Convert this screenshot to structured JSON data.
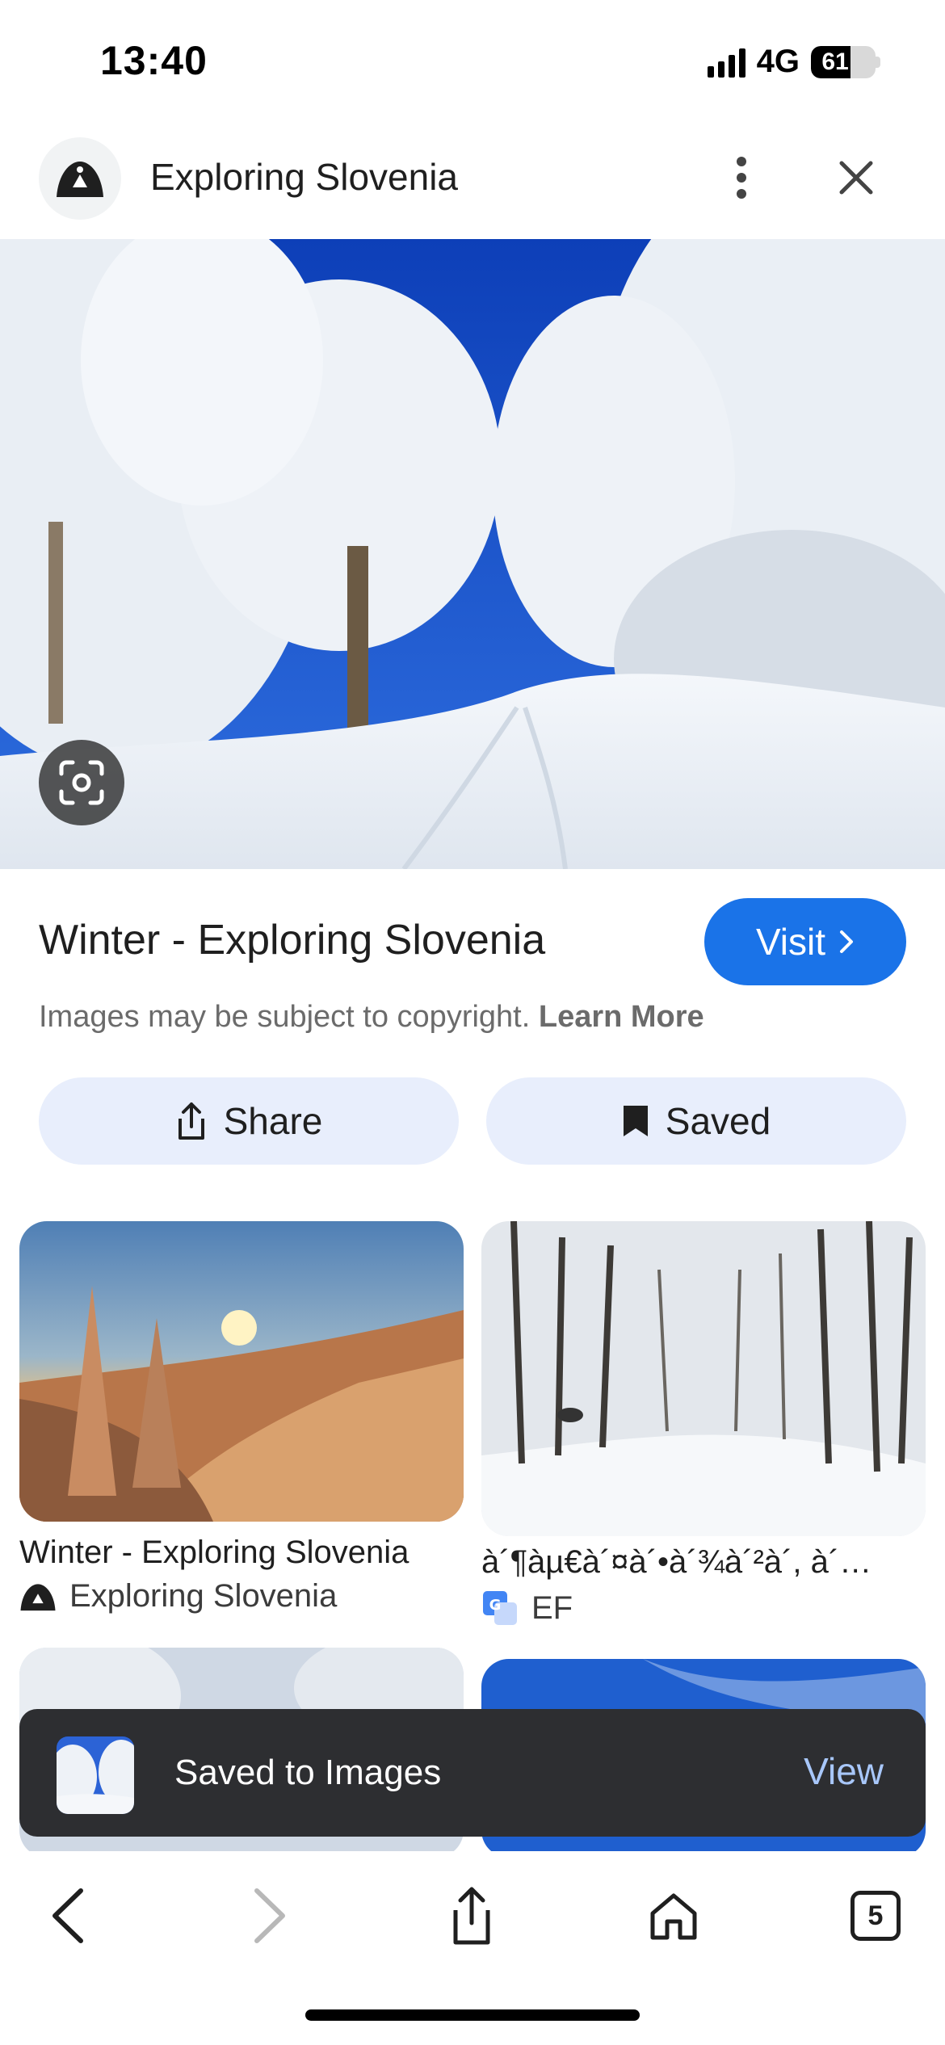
{
  "status_bar": {
    "time": "13:40",
    "network": "4G",
    "battery": "61"
  },
  "header": {
    "title": "Exploring Slovenia",
    "avatar_icon": "site-logo-icon",
    "more_icon": "more-vert-icon",
    "close_icon": "close-icon"
  },
  "result": {
    "title": "Winter - Exploring Slovenia",
    "visit_label": "Visit",
    "copyright_text": "Images may be subject to copyright.",
    "learn_more": "Learn More",
    "share_label": "Share",
    "saved_label": "Saved"
  },
  "related": [
    {
      "title": "Winter - Exploring Slovenia",
      "source": "Exploring Slovenia"
    },
    {
      "title": "à´¶àµ€à´¤à´•à´¾à´²à´, à´…",
      "source": "EF"
    }
  ],
  "snackbar": {
    "message": "Saved to Images",
    "action": "View"
  },
  "toolbar": {
    "tabs_count": "5"
  },
  "colors": {
    "accent": "#1a73e8",
    "chip_bg": "#e8eefc",
    "snackbar_bg": "#2d2e31",
    "snackbar_action": "#a8c7fa"
  }
}
